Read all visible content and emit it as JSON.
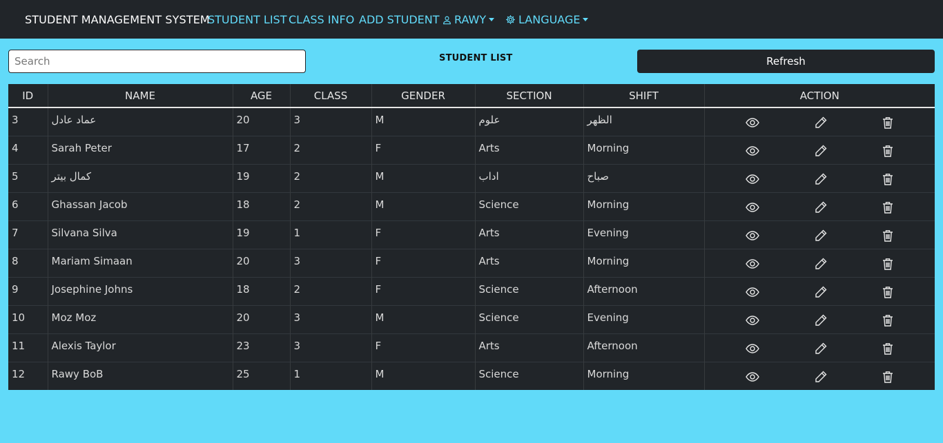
{
  "nav": {
    "brand": "STUDENT MANAGEMENT SYSTEM",
    "student_list": "STUDENT LIST",
    "class_info": "CLASS INFO",
    "add_student": "ADD STUDENT",
    "user": "RAWY",
    "language": "LANGUAGE"
  },
  "search": {
    "placeholder": "Search",
    "value": ""
  },
  "page_title": "STUDENT LIST",
  "refresh_label": "Refresh",
  "table": {
    "headers": [
      "ID",
      "NAME",
      "AGE",
      "CLASS",
      "GENDER",
      "SECTION",
      "SHIFT",
      "ACTION"
    ],
    "rows": [
      {
        "id": "3",
        "name": "عماد عادل",
        "age": "20",
        "class": "3",
        "gender": "M",
        "section": "علوم",
        "shift": "الظهر"
      },
      {
        "id": "4",
        "name": "Sarah Peter",
        "age": "17",
        "class": "2",
        "gender": "F",
        "section": "Arts",
        "shift": "Morning"
      },
      {
        "id": "5",
        "name": "كمال بيتر",
        "age": "19",
        "class": "2",
        "gender": "M",
        "section": "اداب",
        "shift": "صباح"
      },
      {
        "id": "6",
        "name": "Ghassan Jacob",
        "age": "18",
        "class": "2",
        "gender": "M",
        "section": "Science",
        "shift": "Morning"
      },
      {
        "id": "7",
        "name": "Silvana Silva",
        "age": "19",
        "class": "1",
        "gender": "F",
        "section": "Arts",
        "shift": "Evening"
      },
      {
        "id": "8",
        "name": "Mariam Simaan",
        "age": "20",
        "class": "3",
        "gender": "F",
        "section": "Arts",
        "shift": "Morning"
      },
      {
        "id": "9",
        "name": "Josephine Johns",
        "age": "18",
        "class": "2",
        "gender": "F",
        "section": "Science",
        "shift": "Afternoon"
      },
      {
        "id": "10",
        "name": "Moz Moz",
        "age": "20",
        "class": "3",
        "gender": "M",
        "section": "Science",
        "shift": "Evening"
      },
      {
        "id": "11",
        "name": "Alexis Taylor",
        "age": "23",
        "class": "3",
        "gender": "F",
        "section": "Arts",
        "shift": "Afternoon"
      },
      {
        "id": "12",
        "name": "Rawy BoB",
        "age": "25",
        "class": "1",
        "gender": "M",
        "section": "Science",
        "shift": "Morning"
      }
    ]
  },
  "colors": {
    "background": "#61daf9",
    "navbar": "#212529",
    "link": "#61daf9"
  },
  "icons": [
    "user-icon",
    "gear-icon",
    "eye-icon",
    "pencil-icon",
    "trash-icon"
  ]
}
